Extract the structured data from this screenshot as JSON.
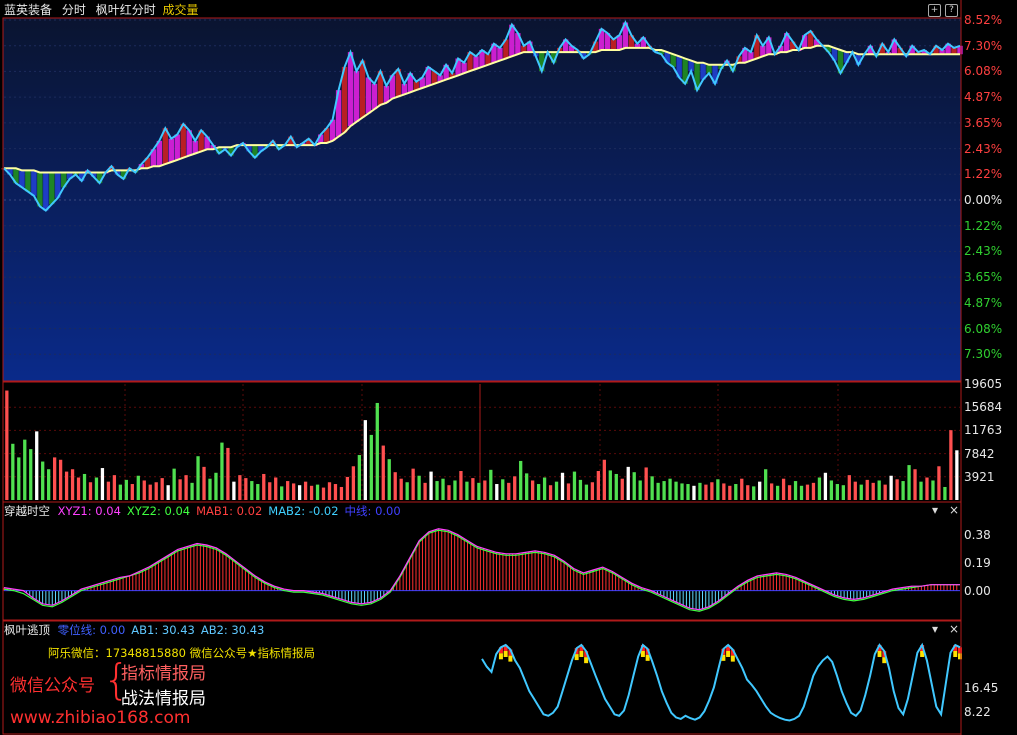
{
  "header": {
    "stock_name": "蓝英装备",
    "mode": "分时",
    "indicator": "枫叶红分时",
    "volume_label": "成交量",
    "colors": {
      "stock_name": "#e8e8e8",
      "indicator": "#e8e8e8",
      "volume_label": "#e8c800"
    }
  },
  "panel_controls": {
    "zoom_icon": "plus-circle-icon",
    "help_icon": "question-mark-icon",
    "collapse_icon": "triangle-down-icon",
    "close_icon": "close-icon"
  },
  "price_axis": {
    "up_ticks": [
      "8.52%",
      "7.30%",
      "6.08%",
      "4.87%",
      "3.65%",
      "2.43%",
      "1.22%"
    ],
    "zero_tick": "0.00%",
    "down_ticks": [
      "1.22%",
      "2.43%",
      "3.65%",
      "4.87%",
      "6.08%",
      "7.30%"
    ],
    "colors": {
      "up": "#ff4040",
      "zero": "#e8e8e8",
      "down": "#30d030"
    }
  },
  "volume_axis": {
    "ticks": [
      "19605",
      "15684",
      "11763",
      "7842",
      "3921"
    ]
  },
  "indicator1": {
    "name": "穿越时空",
    "params": [
      {
        "label": "XYZ1:",
        "value": "0.04",
        "color": "#ff40ff"
      },
      {
        "label": "XYZ2:",
        "value": "0.04",
        "color": "#40ff40"
      },
      {
        "label": "MAB1:",
        "value": "0.02",
        "color": "#ff4040"
      },
      {
        "label": "MAB2:",
        "value": "-0.02",
        "color": "#40d0ff"
      },
      {
        "label": "中线:",
        "value": "0.00",
        "color": "#4040ff"
      }
    ],
    "ticks": [
      "0.38",
      "0.19",
      "0.00"
    ]
  },
  "indicator2": {
    "name": "枫叶逃顶",
    "params": [
      {
        "label": "零位线:",
        "value": "0.00",
        "color": "#4060ff"
      },
      {
        "label": "AB1:",
        "value": "30.43",
        "color": "#60c8ff"
      },
      {
        "label": "AB2:",
        "value": "30.43",
        "color": "#60c8ff"
      }
    ],
    "ticks": [
      "16.45",
      "8.22"
    ]
  },
  "watermark": {
    "contact": "阿乐微信：17348815880    微信公众号★指标情报局",
    "label": "微信公众号",
    "brace": "{",
    "line1": "指标情报局",
    "line2": "战法情报局",
    "url": "www.zhibiao168.com"
  },
  "chart_data": {
    "type": "line",
    "price_pct": [
      1.5,
      1.2,
      0.8,
      0.6,
      0.4,
      0.2,
      -0.3,
      -0.5,
      -0.2,
      0.1,
      0.6,
      1.0,
      1.2,
      0.9,
      1.4,
      1.1,
      0.8,
      1.3,
      1.6,
      1.2,
      1.0,
      1.5,
      1.3,
      1.7,
      2.0,
      2.4,
      2.8,
      3.4,
      2.9,
      3.1,
      3.6,
      3.3,
      2.8,
      3.3,
      3.0,
      2.6,
      2.2,
      2.4,
      2.1,
      2.5,
      2.7,
      2.3,
      2.0,
      2.3,
      2.5,
      2.8,
      2.4,
      2.6,
      3.0,
      2.5,
      2.7,
      2.9,
      2.6,
      3.1,
      3.4,
      3.8,
      5.2,
      6.3,
      7.0,
      6.1,
      6.6,
      5.8,
      5.5,
      6.1,
      5.4,
      5.9,
      6.2,
      5.5,
      6.0,
      5.6,
      5.8,
      6.3,
      6.1,
      5.9,
      6.4,
      6.0,
      6.7,
      6.5,
      7.0,
      6.8,
      7.1,
      6.9,
      7.4,
      7.2,
      7.6,
      8.3,
      7.9,
      7.3,
      7.5,
      6.8,
      6.1,
      7.0,
      6.5,
      7.2,
      7.6,
      7.3,
      7.1,
      6.7,
      6.9,
      7.5,
      8.1,
      7.9,
      7.6,
      7.8,
      8.4,
      7.8,
      7.4,
      7.7,
      7.3,
      7.0,
      6.9,
      6.5,
      6.3,
      5.8,
      5.5,
      6.1,
      5.2,
      5.7,
      6.0,
      5.5,
      6.2,
      6.6,
      6.1,
      6.8,
      7.2,
      7.0,
      7.8,
      7.3,
      7.7,
      6.9,
      7.3,
      7.9,
      7.5,
      7.1,
      7.8,
      8.0,
      7.6,
      7.3,
      7.0,
      6.6,
      6.0,
      6.5,
      7.0,
      6.4,
      6.9,
      7.3,
      6.8,
      7.4,
      7.0,
      7.6,
      7.2,
      6.8,
      7.3,
      7.0,
      7.1,
      6.9,
      7.3,
      7.1,
      7.4,
      7.2,
      7.3
    ],
    "avg_pct": [
      1.5,
      1.5,
      1.5,
      1.4,
      1.4,
      1.4,
      1.3,
      1.3,
      1.3,
      1.3,
      1.3,
      1.3,
      1.3,
      1.3,
      1.3,
      1.3,
      1.3,
      1.3,
      1.4,
      1.4,
      1.4,
      1.4,
      1.4,
      1.5,
      1.5,
      1.6,
      1.6,
      1.7,
      1.8,
      1.9,
      2.0,
      2.1,
      2.2,
      2.3,
      2.4,
      2.4,
      2.5,
      2.5,
      2.5,
      2.6,
      2.6,
      2.6,
      2.6,
      2.6,
      2.6,
      2.6,
      2.6,
      2.6,
      2.6,
      2.6,
      2.6,
      2.6,
      2.6,
      2.7,
      2.7,
      2.8,
      3.0,
      3.2,
      3.5,
      3.7,
      3.9,
      4.1,
      4.3,
      4.5,
      4.6,
      4.8,
      4.9,
      5.0,
      5.1,
      5.2,
      5.3,
      5.4,
      5.5,
      5.6,
      5.7,
      5.8,
      5.9,
      6.0,
      6.1,
      6.2,
      6.3,
      6.4,
      6.5,
      6.6,
      6.7,
      6.8,
      6.9,
      7.0,
      7.0,
      7.0,
      7.0,
      7.0,
      7.0,
      7.0,
      7.0,
      7.0,
      7.0,
      7.0,
      7.0,
      7.0,
      7.1,
      7.1,
      7.1,
      7.1,
      7.2,
      7.2,
      7.2,
      7.2,
      7.2,
      7.1,
      7.1,
      7.0,
      6.9,
      6.8,
      6.7,
      6.6,
      6.5,
      6.5,
      6.4,
      6.4,
      6.4,
      6.4,
      6.4,
      6.5,
      6.5,
      6.6,
      6.7,
      6.8,
      6.9,
      6.9,
      7.0,
      7.0,
      7.1,
      7.1,
      7.2,
      7.2,
      7.3,
      7.3,
      7.3,
      7.2,
      7.1,
      7.0,
      7.0,
      6.9,
      6.9,
      6.9,
      6.9,
      6.9,
      6.9,
      6.9,
      6.9,
      6.9,
      6.9,
      6.9,
      6.9,
      6.9,
      6.9,
      6.9,
      6.9,
      6.9,
      6.9
    ],
    "ylim_pct": [
      -8.52,
      8.52
    ],
    "volume": [
      18500,
      9500,
      7200,
      10200,
      8600,
      11600,
      6500,
      5200,
      7200,
      6800,
      4800,
      5200,
      3800,
      4400,
      3000,
      3800,
      5400,
      3100,
      4200,
      2600,
      3400,
      2700,
      4100,
      3300,
      2600,
      3000,
      3700,
      2500,
      5300,
      3500,
      4200,
      2900,
      7400,
      5600,
      3600,
      4600,
      9700,
      8800,
      3100,
      4200,
      3700,
      3200,
      2700,
      4400,
      3000,
      3800,
      2300,
      3200,
      2800,
      2500,
      3100,
      2400,
      2600,
      2100,
      3000,
      2700,
      2200,
      3900,
      5700,
      7600,
      13500,
      11000,
      16400,
      9200,
      6900,
      4700,
      3600,
      3000,
      5300,
      4100,
      2900,
      4800,
      3200,
      3600,
      2500,
      3300,
      4900,
      3100,
      3700,
      2900,
      3300,
      5100,
      2700,
      3500,
      2900,
      4000,
      6600,
      4500,
      3300,
      2700,
      3800,
      2500,
      3100,
      4600,
      2800,
      4800,
      3400,
      2600,
      3000,
      4900,
      6800,
      5000,
      4400,
      3600,
      5600,
      4700,
      3300,
      5500,
      4000,
      2900,
      3200,
      3600,
      3100,
      2800,
      2700,
      2400,
      2900,
      2600,
      3000,
      3500,
      2800,
      2400,
      2700,
      3600,
      2500,
      2300,
      3100,
      5200,
      2800,
      2400,
      3600,
      2500,
      3200,
      2400,
      2600,
      2900,
      3800,
      4600,
      3300,
      2700,
      2500,
      4200,
      3100,
      2600,
      3400,
      2900,
      3300,
      2600,
      4100,
      3500,
      3200,
      5900,
      5200,
      3100,
      3800,
      3300,
      5700,
      2200,
      11800,
      8400
    ],
    "volume_ylim": [
      0,
      19605
    ],
    "osc_xyz1": [
      0.02,
      0.01,
      0.0,
      -0.05,
      -0.09,
      -0.1,
      -0.07,
      -0.03,
      0.01,
      0.03,
      0.05,
      0.07,
      0.09,
      0.1,
      0.13,
      0.16,
      0.2,
      0.24,
      0.28,
      0.3,
      0.32,
      0.31,
      0.29,
      0.25,
      0.2,
      0.15,
      0.1,
      0.06,
      0.03,
      0.01,
      0.0,
      0.0,
      -0.01,
      -0.02,
      -0.04,
      -0.06,
      -0.08,
      -0.09,
      -0.08,
      -0.05,
      0.0,
      0.1,
      0.22,
      0.34,
      0.4,
      0.42,
      0.41,
      0.38,
      0.34,
      0.3,
      0.28,
      0.26,
      0.25,
      0.25,
      0.26,
      0.27,
      0.26,
      0.24,
      0.2,
      0.15,
      0.12,
      0.14,
      0.16,
      0.13,
      0.09,
      0.05,
      0.02,
      0.0,
      -0.03,
      -0.06,
      -0.09,
      -0.12,
      -0.13,
      -0.11,
      -0.07,
      -0.02,
      0.03,
      0.07,
      0.1,
      0.11,
      0.12,
      0.11,
      0.09,
      0.06,
      0.03,
      0.0,
      -0.03,
      -0.05,
      -0.06,
      -0.05,
      -0.03,
      -0.01,
      0.01,
      0.02,
      0.03,
      0.03,
      0.04,
      0.04,
      0.04,
      0.04
    ],
    "osc_xyz2": [
      0.01,
      0.0,
      -0.02,
      -0.06,
      -0.1,
      -0.11,
      -0.08,
      -0.04,
      0.0,
      0.02,
      0.04,
      0.06,
      0.08,
      0.1,
      0.12,
      0.15,
      0.19,
      0.23,
      0.27,
      0.29,
      0.31,
      0.3,
      0.28,
      0.24,
      0.19,
      0.14,
      0.09,
      0.05,
      0.02,
      0.0,
      -0.01,
      -0.01,
      -0.02,
      -0.03,
      -0.05,
      -0.07,
      -0.09,
      -0.1,
      -0.09,
      -0.06,
      -0.01,
      0.09,
      0.21,
      0.33,
      0.39,
      0.41,
      0.4,
      0.37,
      0.33,
      0.29,
      0.27,
      0.25,
      0.24,
      0.24,
      0.25,
      0.26,
      0.25,
      0.23,
      0.19,
      0.14,
      0.11,
      0.13,
      0.15,
      0.12,
      0.08,
      0.04,
      0.01,
      -0.01,
      -0.04,
      -0.07,
      -0.1,
      -0.13,
      -0.14,
      -0.12,
      -0.08,
      -0.03,
      0.02,
      0.06,
      0.09,
      0.1,
      0.11,
      0.1,
      0.08,
      0.05,
      0.02,
      -0.01,
      -0.04,
      -0.06,
      -0.07,
      -0.06,
      -0.04,
      -0.02,
      0.0,
      0.01,
      0.02,
      0.03,
      0.04,
      0.04,
      0.04,
      0.04
    ],
    "osc_ylim": [
      -0.2,
      0.48
    ],
    "top_ab": [
      82,
      72,
      65,
      88,
      97,
      100,
      94,
      80,
      70,
      55,
      40,
      30,
      20,
      10,
      8,
      12,
      20,
      40,
      60,
      80,
      96,
      100,
      92,
      76,
      60,
      45,
      30,
      20,
      10,
      8,
      15,
      35,
      60,
      85,
      100,
      95,
      78,
      60,
      40,
      25,
      12,
      6,
      4,
      8,
      5,
      3,
      6,
      14,
      28,
      45,
      70,
      95,
      100,
      94,
      82,
      70,
      55,
      48,
      40,
      30,
      20,
      12,
      8,
      5,
      3,
      2,
      4,
      8,
      20,
      40,
      60,
      72,
      80,
      85,
      78,
      60,
      40,
      25,
      12,
      8,
      15,
      35,
      60,
      88,
      100,
      92,
      70,
      40,
      18,
      10,
      30,
      60,
      90,
      100,
      80,
      50,
      20,
      10,
      50,
      90,
      100,
      97
    ],
    "top_ylim": [
      0,
      100
    ]
  }
}
